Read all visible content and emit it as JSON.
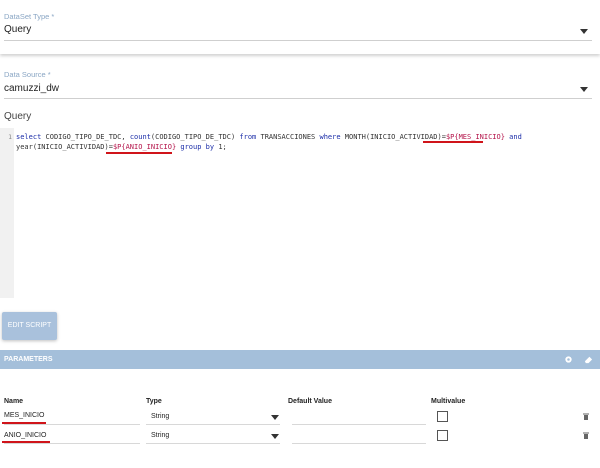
{
  "dataset_type": {
    "label": "DataSet Type *",
    "value": "Query"
  },
  "data_source": {
    "label": "Data Source *",
    "value": "camuzzi_dw"
  },
  "query": {
    "label": "Query",
    "line_number": "1",
    "line1": {
      "seg1": "select ",
      "seg2": "CODIGO_TIPO_DE_TDC, ",
      "seg3": "count",
      "seg4": "(CODIGO_TIPO_DE_TDC) ",
      "seg5": "from ",
      "seg6": "TRANSACCIONES ",
      "seg7": "where ",
      "seg8": "MONTH(INICIO_ACTIVIDAD)=",
      "seg9": "$P{MES_INICIO}",
      "seg10": " and"
    },
    "line2": {
      "seg1": "year(INICIO_ACTIVIDAD)=",
      "seg2": "$P{ANIO_INICIO}",
      "seg3": " group by ",
      "seg4": "1;"
    }
  },
  "edit_button": {
    "label": "EDIT SCRIPT"
  },
  "parameters": {
    "title": "PARAMETERS",
    "columns": {
      "name": "Name",
      "type": "Type",
      "default": "Default Value",
      "multivalue": "Multivalue"
    },
    "rows": [
      {
        "name": "MES_INICIO",
        "type": "String",
        "default": "",
        "multivalue": false
      },
      {
        "name": "ANIO_INICIO",
        "type": "String",
        "default": "",
        "multivalue": false
      }
    ]
  },
  "colors": {
    "accent": "#a4bfda",
    "highlight": "#d0141a",
    "keyword": "#1b2da8",
    "variable": "#b4144a"
  }
}
